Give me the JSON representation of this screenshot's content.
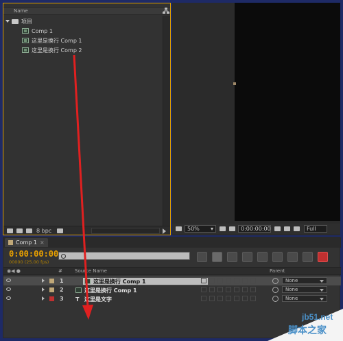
{
  "project_panel": {
    "column_name": "Name",
    "items": [
      {
        "label": "项目",
        "type": "folder"
      },
      {
        "label": "Comp 1",
        "type": "comp"
      },
      {
        "label": "这里是换行 Comp 1",
        "type": "comp"
      },
      {
        "label": "这里是换行 Comp 2",
        "type": "comp"
      }
    ],
    "bpc": "8 bpc"
  },
  "viewer": {
    "zoom": "50%",
    "timecode": "0:00:00:00",
    "resolution": "Full"
  },
  "timeline": {
    "tab_label": "Comp 1",
    "timecode": "0:00:00:00",
    "frame_info": "00000 (25.00 fps)",
    "search_placeholder": "",
    "columns": {
      "hash": "#",
      "source_name": "Source Name",
      "parent": "Parent"
    },
    "layers": [
      {
        "num": "1",
        "name": "这里是换行 Comp 1",
        "type": "comp",
        "color": "#c0a878",
        "parent": "None",
        "selected": true
      },
      {
        "num": "2",
        "name": "这里是换行 Comp 1",
        "type": "comp",
        "color": "#c0a878",
        "parent": "None",
        "selected": false
      },
      {
        "num": "3",
        "name": "这里是文字",
        "type": "text",
        "color": "#c03030",
        "parent": "None",
        "selected": false
      }
    ]
  },
  "watermark": {
    "url": "jb51.net",
    "site": "脚本之家"
  },
  "colors": {
    "accent": "#e8a000",
    "arrow": "#e02020",
    "background": "#1e2a66"
  }
}
